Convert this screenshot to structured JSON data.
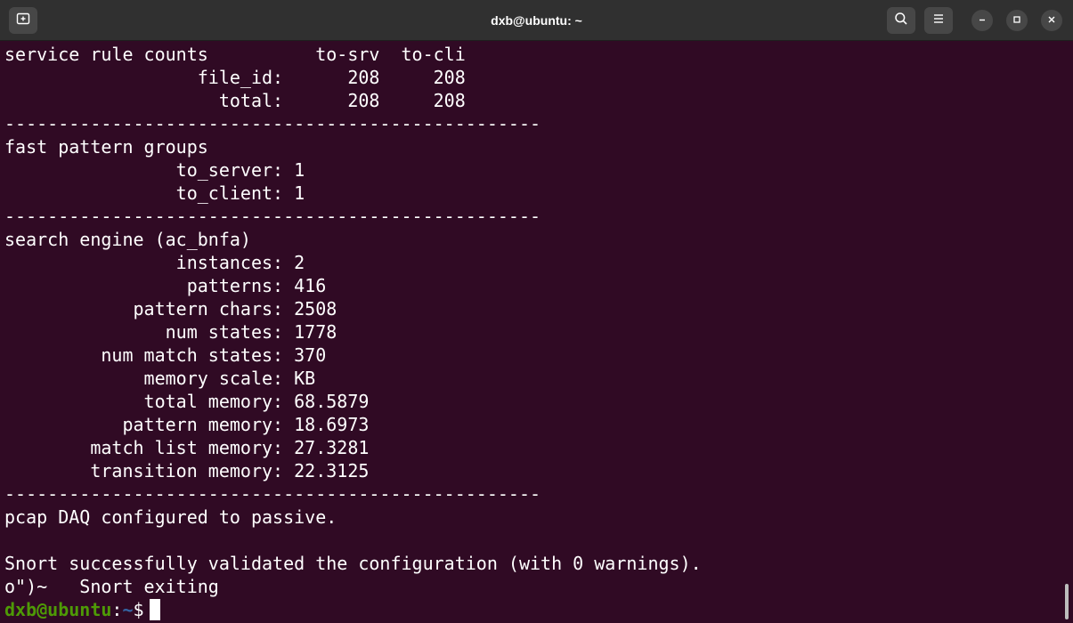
{
  "window": {
    "title": "dxb@ubuntu: ~"
  },
  "icons": {
    "new_tab": "new-tab-icon",
    "search": "search-icon",
    "menu": "hamburger-menu-icon",
    "minimize": "minimize-icon",
    "maximize": "maximize-icon",
    "close": "close-icon"
  },
  "colors": {
    "terminal_bg": "#300a24",
    "titlebar_bg": "#303030",
    "prompt_user": "#4e9a06",
    "prompt_path": "#3465a4",
    "text": "#ffffff"
  },
  "terminal": {
    "lines": [
      "service rule counts          to-srv  to-cli",
      "                  file_id:      208     208",
      "                    total:      208     208",
      "--------------------------------------------------",
      "fast pattern groups",
      "                to_server: 1",
      "                to_client: 1",
      "--------------------------------------------------",
      "search engine (ac_bnfa)",
      "                instances: 2",
      "                 patterns: 416",
      "            pattern chars: 2508",
      "               num states: 1778",
      "         num match states: 370",
      "             memory scale: KB",
      "             total memory: 68.5879",
      "           pattern memory: 18.6973",
      "        match list memory: 27.3281",
      "        transition memory: 22.3125",
      "--------------------------------------------------",
      "pcap DAQ configured to passive.",
      "",
      "Snort successfully validated the configuration (with 0 warnings).",
      "o\")~   Snort exiting"
    ],
    "prompt": {
      "user_host": "dxb@ubuntu",
      "separator": ":",
      "path": "~",
      "symbol": "$"
    }
  }
}
